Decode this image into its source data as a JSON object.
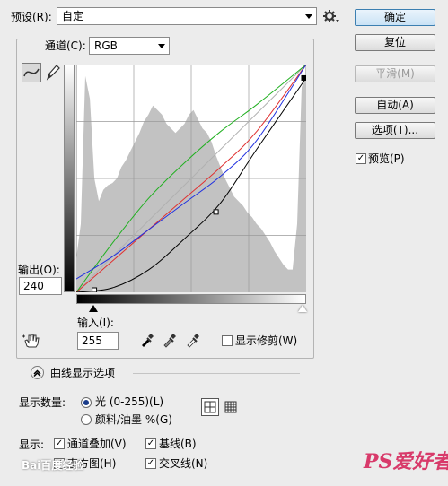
{
  "preset": {
    "label": "预设(R):",
    "value": "自定",
    "gear_icon": "gear-icon"
  },
  "channel": {
    "label": "通道(C):",
    "value": "RGB"
  },
  "buttons": {
    "ok": "确定",
    "reset": "复位",
    "smooth": "平滑(M)",
    "auto": "自动(A)",
    "options": "选项(T)..."
  },
  "preview": {
    "label": "预览(P)",
    "checked": true
  },
  "output": {
    "label": "输出(O):",
    "value": "240"
  },
  "input": {
    "label": "输入(I):",
    "value": "255"
  },
  "show_clipping": {
    "label": "显示修剪(W)",
    "checked": false
  },
  "curve_display_options": {
    "label": "曲线显示选项"
  },
  "show_amount": {
    "label": "显示数量:",
    "option_light": "光 (0-255)(L)",
    "option_pigment": "颜料/油墨 %(G)",
    "selected": "light"
  },
  "show": {
    "label": "显示:",
    "channel_overlays": "通道叠加(V)",
    "baseline": "基线(B)",
    "histogram": "直方图(H)",
    "intersection_line": "交叉线(N)"
  },
  "watermarks": {
    "left": "Bai百度经验",
    "right": "PS爱好者"
  },
  "colors": {
    "red_curve": "#e03030",
    "green_curve": "#20b020",
    "blue_curve": "#2030e0",
    "composite_curve": "#000000",
    "histogram": "#c2c2c2"
  },
  "chart_data": {
    "type": "line",
    "xlim": [
      0,
      255
    ],
    "ylim": [
      0,
      255
    ],
    "grid": true,
    "histogram": {
      "x": [
        0,
        5,
        10,
        15,
        20,
        25,
        30,
        35,
        40,
        45,
        50,
        55,
        60,
        65,
        70,
        75,
        80,
        85,
        90,
        95,
        100,
        105,
        110,
        115,
        120,
        125,
        130,
        135,
        140,
        145,
        150,
        155,
        160,
        165,
        170,
        175,
        180,
        185,
        190,
        195,
        200,
        205,
        210,
        215,
        220,
        225,
        230,
        235,
        240,
        245,
        250,
        255
      ],
      "y": [
        0.15,
        0.3,
        0.95,
        0.85,
        0.5,
        0.4,
        0.45,
        0.47,
        0.48,
        0.5,
        0.55,
        0.58,
        0.62,
        0.66,
        0.7,
        0.75,
        0.78,
        0.82,
        0.8,
        0.78,
        0.74,
        0.72,
        0.7,
        0.72,
        0.74,
        0.78,
        0.8,
        0.76,
        0.72,
        0.7,
        0.66,
        0.6,
        0.55,
        0.5,
        0.46,
        0.42,
        0.4,
        0.38,
        0.35,
        0.33,
        0.3,
        0.28,
        0.25,
        0.22,
        0.18,
        0.15,
        0.12,
        0.1,
        0.1,
        0.3,
        0.9,
        0.95
      ]
    },
    "series": [
      {
        "color": "green",
        "x": [
          0,
          40,
          80,
          120,
          160,
          200,
          255
        ],
        "y": [
          0,
          55,
          105,
          145,
          180,
          210,
          255
        ]
      },
      {
        "color": "red",
        "x": [
          0,
          40,
          80,
          120,
          160,
          200,
          255
        ],
        "y": [
          0,
          35,
          70,
          105,
          140,
          180,
          255
        ]
      },
      {
        "color": "blue",
        "x": [
          0,
          40,
          80,
          120,
          160,
          200,
          255
        ],
        "y": [
          15,
          40,
          70,
          100,
          130,
          170,
          255
        ]
      },
      {
        "color": "composite",
        "x": [
          0,
          40,
          80,
          120,
          160,
          200,
          255
        ],
        "y": [
          0,
          5,
          25,
          60,
          100,
          160,
          240
        ]
      }
    ],
    "control_points": [
      {
        "x": 20,
        "y": 0
      },
      {
        "x": 155,
        "y": 90
      },
      {
        "x": 255,
        "y": 240
      }
    ]
  }
}
